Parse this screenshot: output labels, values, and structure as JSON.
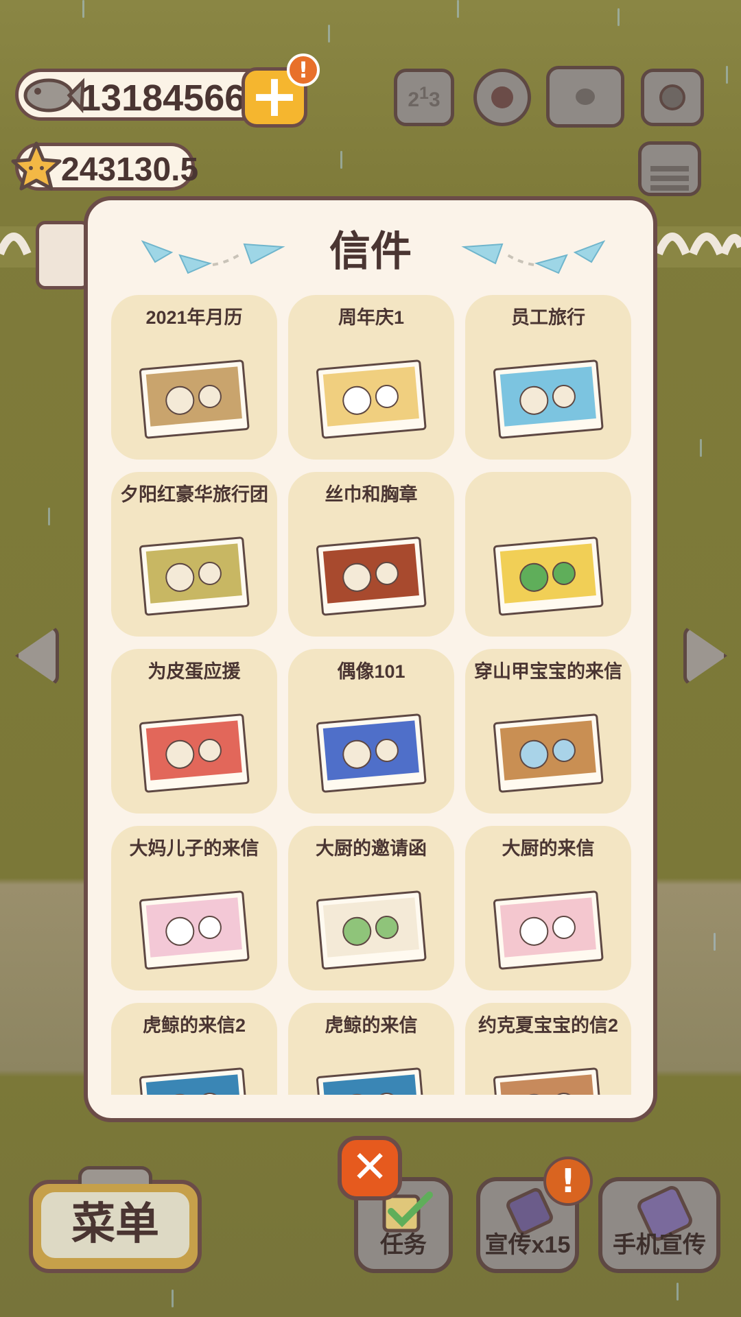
{
  "currency": {
    "fish_value": "13184566",
    "star_value": "243130.5",
    "plus_label": "+",
    "alert_label": "!"
  },
  "top_icons": [
    "ranking-icon",
    "gear-icon",
    "paw-book-icon",
    "camera-icon",
    "newspaper-icon"
  ],
  "modal": {
    "title": "信件",
    "cards": [
      {
        "title": "2021年月历",
        "art": "calendar-icon"
      },
      {
        "title": "周年庆1",
        "art": "cake-photo-icon"
      },
      {
        "title": "员工旅行",
        "art": "travel-photos-icon"
      },
      {
        "title": "夕阳红豪华旅行团",
        "art": "brochure-icon"
      },
      {
        "title": "丝巾和胸章",
        "art": "scarf-badge-icon"
      },
      {
        "title": "",
        "art": "poster-icon"
      },
      {
        "title": "为皮蛋应援",
        "art": "fan-sign-icon"
      },
      {
        "title": "偶像101",
        "art": "idol-card-icon"
      },
      {
        "title": "穿山甲宝宝的来信",
        "art": "pangolin-photo-icon"
      },
      {
        "title": "大妈儿子的来信",
        "art": "paris-photo-icon"
      },
      {
        "title": "大厨的邀请函",
        "art": "invitation-card-icon"
      },
      {
        "title": "大厨的来信",
        "art": "group-photo-icon"
      },
      {
        "title": "虎鲸的来信2",
        "art": "orca-photo-icon"
      },
      {
        "title": "虎鲸的来信",
        "art": "orca-photo-icon"
      },
      {
        "title": "约克夏宝宝的信2",
        "art": "yorkie-photo-icon"
      }
    ]
  },
  "bottom": {
    "menu_label": "菜单",
    "close_label": "✕",
    "task_label": "任务",
    "promo_label": "宣传x15",
    "phone_promo_label": "手机宣传",
    "alert_label": "!"
  },
  "colors": {
    "frame": "#6b4c48",
    "panel": "#fbf3e9",
    "card": "#f3e5c3",
    "accent_orange": "#e65a1e",
    "coin_yellow": "#f5b62f"
  }
}
